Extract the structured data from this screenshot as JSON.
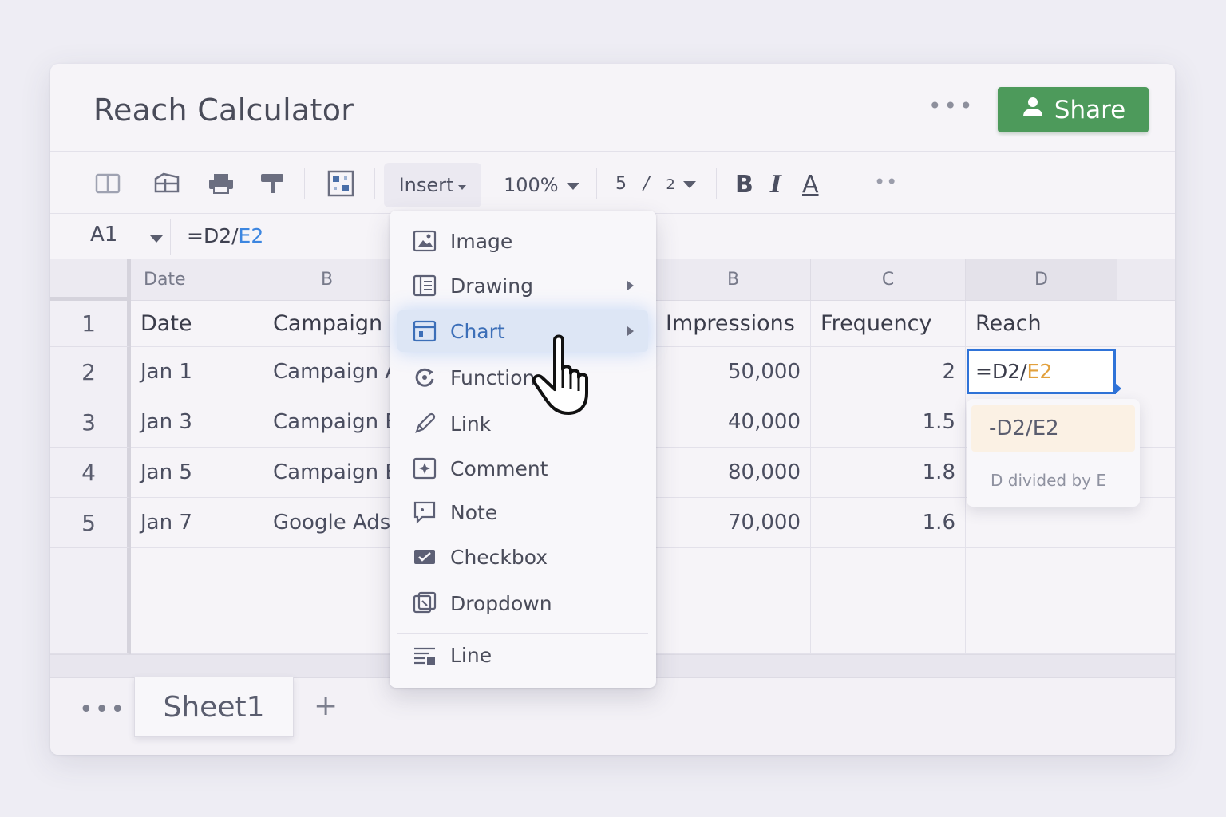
{
  "title": "Reach Calculator",
  "title_more": "•••",
  "share": {
    "label": "Share",
    "icon": "user-icon",
    "color": "#4d9a5b"
  },
  "toolbar": {
    "insert_label": "Insert",
    "zoom": "100%",
    "page_current": "5",
    "page_sep": "/",
    "page_total": "2",
    "bold": "B",
    "italic": "I",
    "text_color": "A",
    "more": "••"
  },
  "formula_bar": {
    "cell_ref": "A1",
    "formula_prefix": "=D2/",
    "formula_ref": "E2"
  },
  "columns": {
    "left": [
      "Date",
      "B"
    ],
    "right": [
      "B",
      "C",
      "D"
    ]
  },
  "rows": [
    "1",
    "2",
    "3",
    "4",
    "5"
  ],
  "table": {
    "headers": {
      "date": "Date",
      "campaign": "Campaign",
      "impressions": "Impressions",
      "frequency": "Frequency",
      "reach": "Reach"
    },
    "data": [
      {
        "date": "Jan 1",
        "campaign": "Campaign A",
        "impressions": "50,000",
        "frequency": "2"
      },
      {
        "date": "Jan 3",
        "campaign": "Campaign B",
        "impressions": "40,000",
        "frequency": "1.5"
      },
      {
        "date": "Jan 5",
        "campaign": "Campaign B",
        "impressions": "80,000",
        "frequency": "1.8"
      },
      {
        "date": "Jan 7",
        "campaign": "Google Ads",
        "impressions": "70,000",
        "frequency": "1.6"
      }
    ]
  },
  "active_cell": {
    "prefix": "=D2/",
    "ref": "E2",
    "color": "#2f73d8",
    "ref_color": "#e2a03c"
  },
  "suggestion": {
    "formula": "-D2/E2",
    "description": "D divided by E"
  },
  "insert_menu": [
    {
      "label": "Image",
      "icon": "image-icon"
    },
    {
      "label": "Drawing",
      "icon": "drawing-icon",
      "submenu": true
    },
    {
      "label": "Chart",
      "icon": "chart-icon",
      "submenu": true,
      "active": true
    },
    {
      "label": "Function",
      "icon": "function-icon"
    },
    {
      "label": "Link",
      "icon": "link-icon"
    },
    {
      "label": "Comment",
      "icon": "comment-icon"
    },
    {
      "label": "Note",
      "icon": "note-icon"
    },
    {
      "label": "Checkbox",
      "icon": "checkbox-icon"
    },
    {
      "label": "Dropdown",
      "icon": "dropdown-icon"
    },
    {
      "label": "Line",
      "icon": "line-icon"
    }
  ],
  "sheets": {
    "more": "•••",
    "tabs": [
      "Sheet1"
    ],
    "add": "+"
  }
}
